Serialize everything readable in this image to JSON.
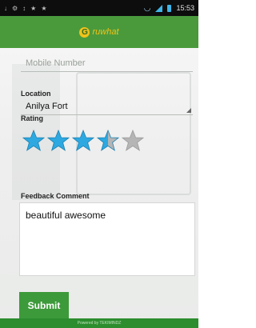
{
  "status_bar": {
    "left_icons": [
      "↓",
      "⚙",
      "↕",
      "★",
      "★"
    ],
    "time": "15:53"
  },
  "app_bar": {
    "logo_mark": "G",
    "logo_text": "ruwhat"
  },
  "form": {
    "mobile_placeholder": "Mobile Number",
    "location_label": "Location",
    "location_value": "Anilya Fort",
    "rating_label": "Rating",
    "rating": 3.5,
    "rating_max": 5,
    "feedback_label": "Feedback Comment",
    "feedback_value": "beautiful awesome",
    "submit_label": "Submit"
  },
  "footer": {
    "text": "Powered by TEKIMINDZ"
  },
  "colors": {
    "header_green": "#4a9a3c",
    "star_filled": "#2ea8e0",
    "star_empty": "#b5b5b5"
  }
}
